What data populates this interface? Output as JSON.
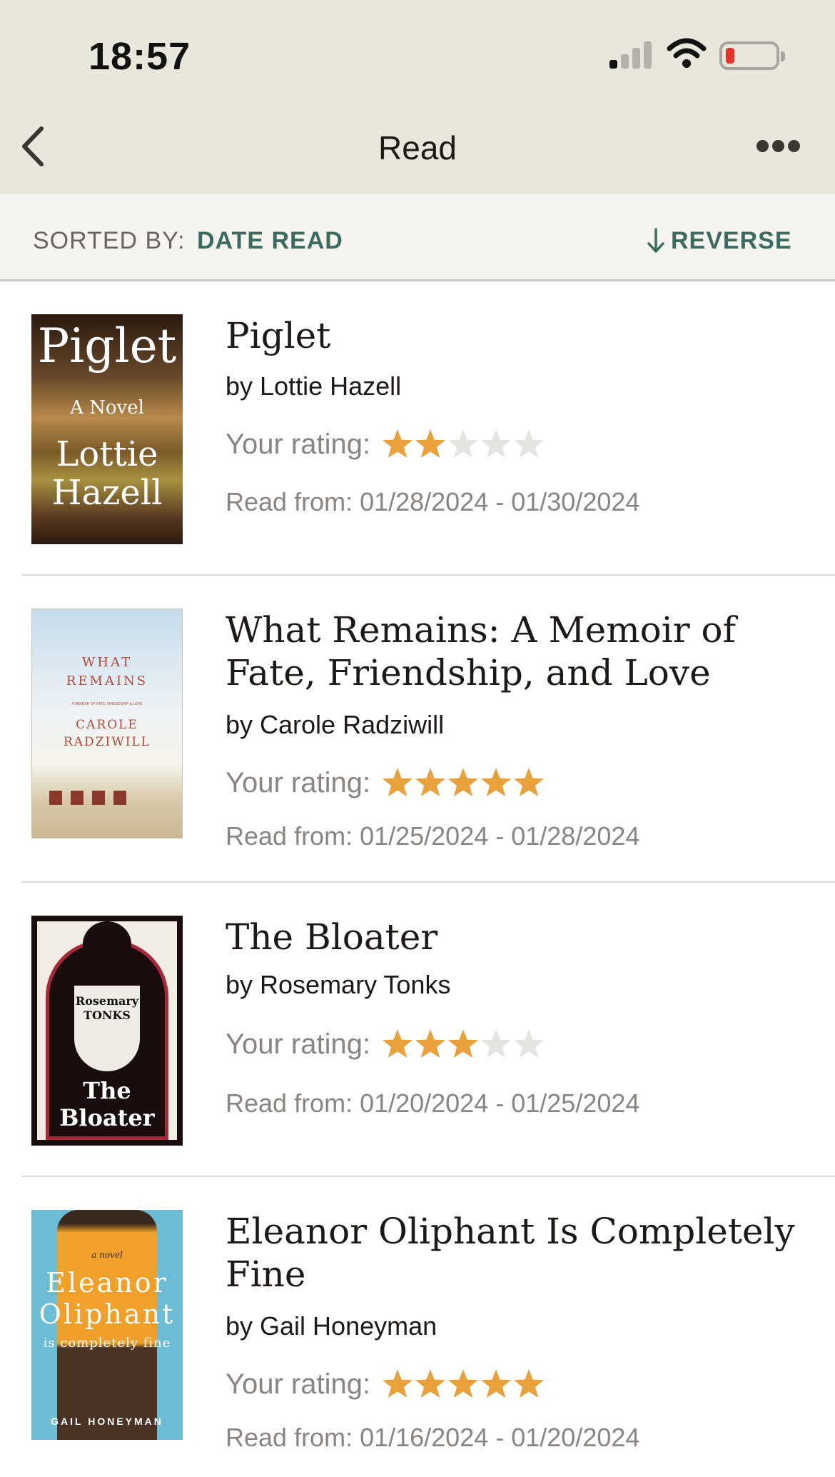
{
  "status": {
    "time": "18:57"
  },
  "nav": {
    "title": "Read"
  },
  "sort": {
    "label": "SORTED BY:",
    "value": "DATE READ",
    "reverse": "REVERSE"
  },
  "rating_label": "Your rating:",
  "colors": {
    "star_on": "#e9a23b",
    "star_off": "#e5e4e0",
    "accent": "#3b6b60"
  },
  "books": [
    {
      "title": "Piglet",
      "author": "by Lottie Hazell",
      "rating": 2,
      "dates": "Read from: 01/28/2024 - 01/30/2024",
      "cover": {
        "title": "Piglet",
        "subtitle": "A Novel",
        "author_line1": "Lottie",
        "author_line2": "Hazell"
      }
    },
    {
      "title": "What Remains: A Memoir of Fate, Friendship, and Love",
      "author": "by Carole Radziwill",
      "rating": 5,
      "dates": "Read from: 01/25/2024 - 01/28/2024",
      "cover": {
        "title_line1": "WHAT",
        "title_line2": "REMAINS",
        "subtitle": "A MEMOIR OF FATE, FRIENDSHIP & LOVE",
        "author_line1": "CAROLE",
        "author_line2": "RADZIWILL"
      }
    },
    {
      "title": "The Bloater",
      "author": "by Rosemary Tonks",
      "rating": 3,
      "dates": "Read from: 01/20/2024 - 01/25/2024",
      "cover": {
        "author_line1": "Rosemary",
        "author_line2": "TONKS",
        "title_line1": "The",
        "title_line2": "Bloater"
      }
    },
    {
      "title": "Eleanor Oliphant Is Completely Fine",
      "author": "by Gail Honeyman",
      "rating": 5,
      "dates": "Read from: 01/16/2024 - 01/20/2024",
      "cover": {
        "kicker": "a novel",
        "title_line1": "Eleanor",
        "title_line2": "Oliphant",
        "title_line3": "is completely fine",
        "author": "GAIL HONEYMAN"
      }
    }
  ]
}
